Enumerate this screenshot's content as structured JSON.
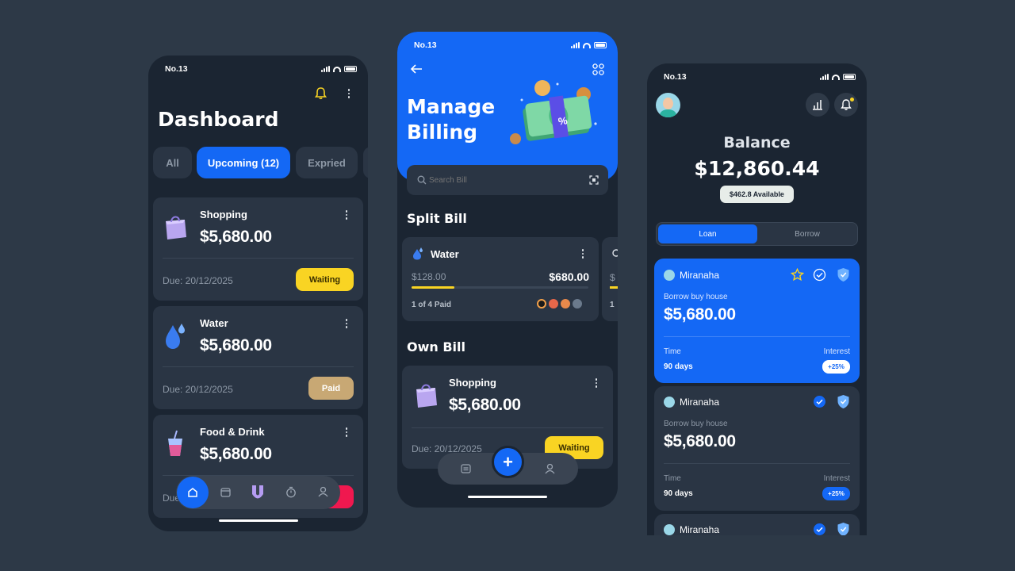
{
  "phone1": {
    "status": {
      "carrier": "No.13"
    },
    "title": "Dashboard",
    "tabs": [
      {
        "label": "All",
        "active": false
      },
      {
        "label": "Upcoming (12)",
        "active": true
      },
      {
        "label": "Expried",
        "active": false
      }
    ],
    "bills": [
      {
        "name": "Shopping",
        "amount": "$5,680.00",
        "due": "Due: 20/12/2025",
        "status": "Waiting",
        "status_color": "#f9d423",
        "icon": "shopping-bag-icon"
      },
      {
        "name": "Water",
        "amount": "$5,680.00",
        "due": "Due: 20/12/2025",
        "status": "Paid",
        "status_color": "#c8a874",
        "icon": "water-drop-icon"
      },
      {
        "name": "Food & Drink",
        "amount": "$5,680.00",
        "due": "Due",
        "status": "",
        "status_color": "#f0184f",
        "icon": "drink-cup-icon"
      }
    ],
    "nav": [
      "home-icon",
      "calendar-icon",
      "logo-icon",
      "timer-icon",
      "profile-icon"
    ]
  },
  "phone2": {
    "status": {
      "carrier": "No.13"
    },
    "title_line1": "Manage",
    "title_line2": "Billing",
    "search_placeholder": "Search Bill",
    "split_heading": "Split Bill",
    "split_card": {
      "name": "Water",
      "paid_amount": "$128.00",
      "total": "$680.00",
      "progress": 0.24,
      "paid_count": "1 of 4 Paid"
    },
    "peek_card": {
      "amount_fragment": "$",
      "count_fragment": "1"
    },
    "own_heading": "Own Bill",
    "own_card": {
      "name": "Shopping",
      "amount": "$5,680.00",
      "due": "Due: 20/12/2025",
      "status": "Waiting"
    },
    "percent_symbol": "%",
    "nav_plus": "+"
  },
  "phone3": {
    "status": {
      "carrier": "No.13"
    },
    "balance_label": "Balance",
    "balance": "$12,860.44",
    "available": "$462.8 Available",
    "toggle": [
      {
        "label": "Loan",
        "active": true
      },
      {
        "label": "Borrow",
        "active": false
      }
    ],
    "loans": [
      {
        "name": "Miranaha",
        "desc": "Borrow buy house",
        "amount": "$5,680.00",
        "time_label": "Time",
        "time": "90 days",
        "interest_label": "Interest",
        "interest": "+25%",
        "highlight": true
      },
      {
        "name": "Miranaha",
        "desc": "Borrow buy house",
        "amount": "$5,680.00",
        "time_label": "Time",
        "time": "90 days",
        "interest_label": "Interest",
        "interest": "+25%",
        "highlight": false
      },
      {
        "name": "Miranaha",
        "highlight": false
      }
    ]
  },
  "colors": {
    "accent": "#1468f5",
    "background": "#2d3947",
    "phone": "#1b2532",
    "card": "#2a3544",
    "waiting": "#f9d423",
    "paid": "#c8a874"
  }
}
